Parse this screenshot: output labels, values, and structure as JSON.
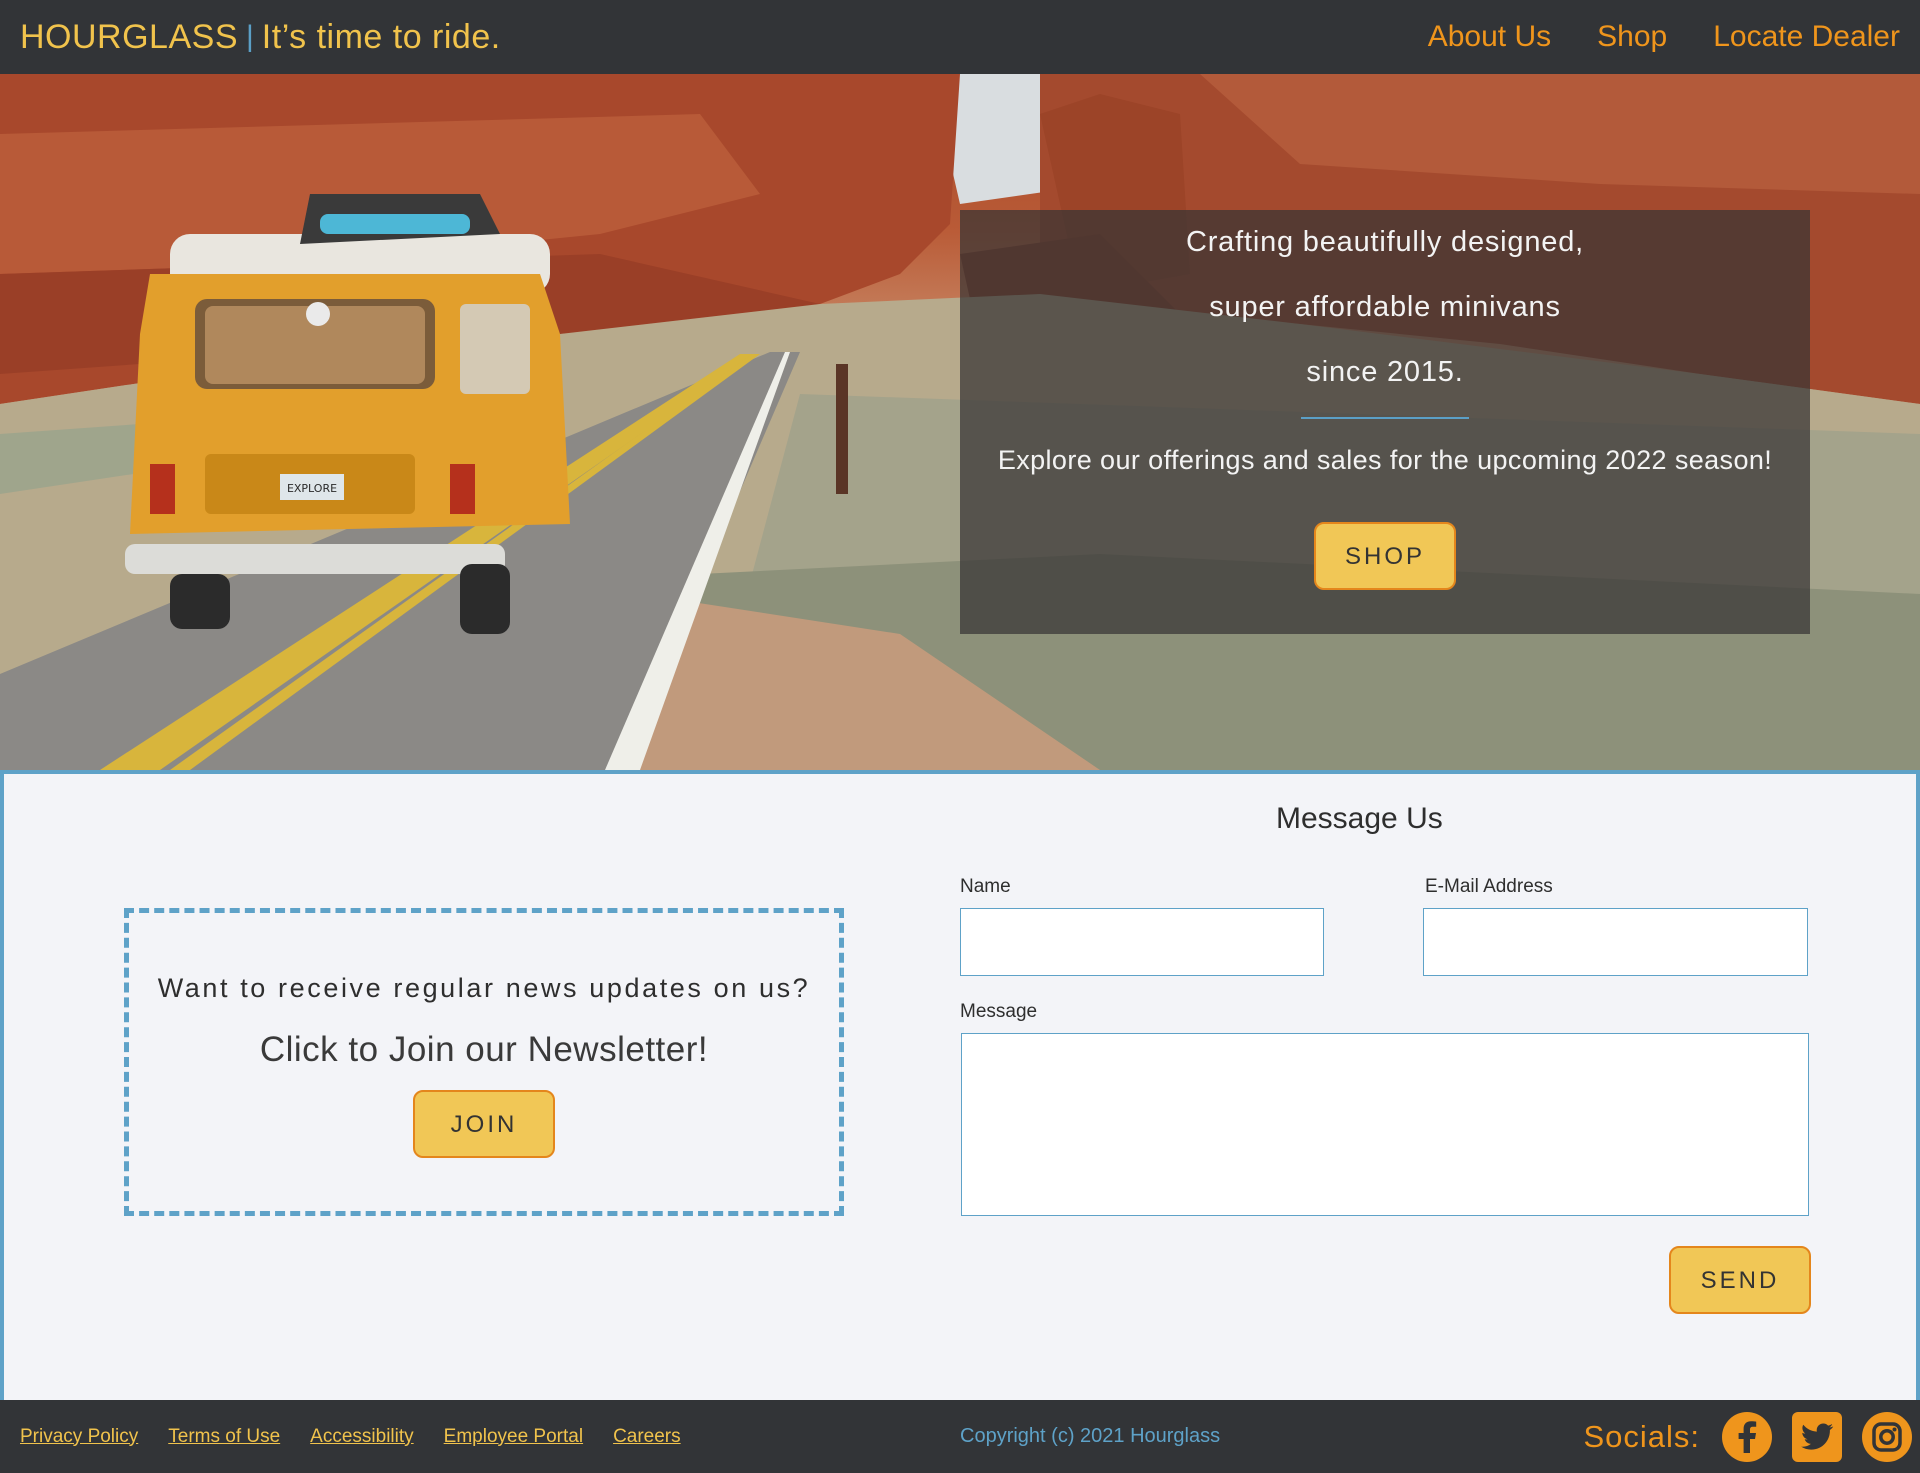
{
  "header": {
    "brand_name": "HOURGLASS",
    "brand_separator": "|",
    "tagline": "It’s time to ride.",
    "nav": [
      "About Us",
      "Shop",
      "Locate Dealer"
    ]
  },
  "hero": {
    "lines": [
      "Crafting beautifully designed,",
      "super affordable minivans",
      "since 2015."
    ],
    "subtext": "Explore our offerings and sales for the upcoming 2022 season!",
    "cta_label": "SHOP",
    "van_plate": "EXPLORE"
  },
  "newsletter": {
    "question": "Want to receive regular news updates on us?",
    "cta": "Click to Join our Newsletter!",
    "button_label": "JOIN"
  },
  "form": {
    "title": "Message Us",
    "name_label": "Name",
    "name_value": "",
    "email_label": "E-Mail Address",
    "email_value": "",
    "message_label": "Message",
    "message_value": "",
    "send_label": "SEND"
  },
  "footer": {
    "links": [
      "Privacy Policy",
      "Terms of Use",
      "Accessibility",
      "Employee Portal",
      "Careers"
    ],
    "copyright": "Copyright (c) 2021 Hourglass",
    "socials_label": "Socials:",
    "social_icons": [
      "facebook-icon",
      "twitter-icon",
      "instagram-icon"
    ]
  },
  "colors": {
    "header_bg": "#323437",
    "brand_yellow": "#f1c34c",
    "nav_orange": "#ef951c",
    "accent_blue": "#5ea2c8",
    "button_fill": "#f1c756",
    "button_border": "#e4861c"
  }
}
